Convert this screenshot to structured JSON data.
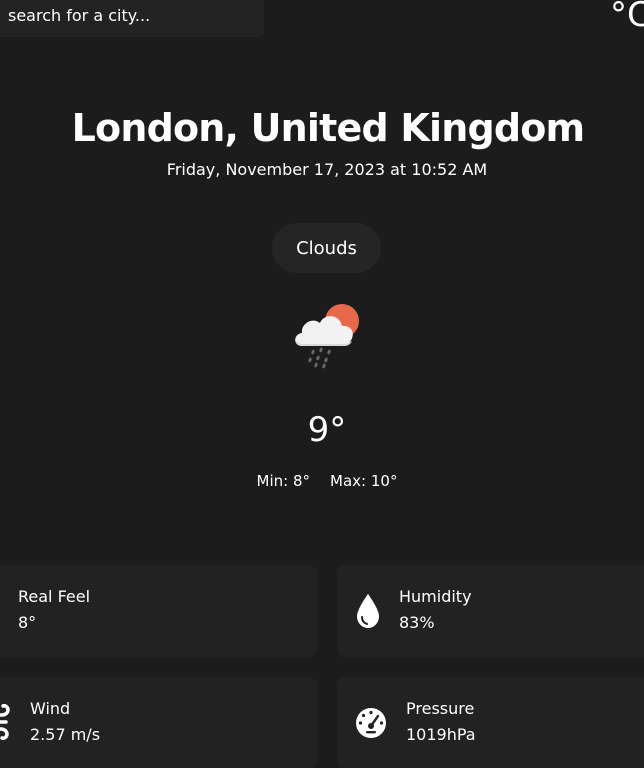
{
  "search": {
    "placeholder": "search for a city..."
  },
  "unit_toggle": {
    "label": "°C"
  },
  "location": {
    "title": "London, United Kingdom",
    "datetime": "Friday, November 17, 2023 at 10:52 AM"
  },
  "current": {
    "condition": "Clouds",
    "condition_icon": "cloud-rain-sun-icon",
    "temperature": "9°",
    "min_label": "Min: 8°",
    "max_label": "Max: 10°"
  },
  "details": [
    {
      "label": "Real Feel",
      "value": "8°",
      "icon": "thermometer-icon"
    },
    {
      "label": "Humidity",
      "value": "83%",
      "icon": "droplet-icon"
    },
    {
      "label": "Wind",
      "value": "2.57 m/s",
      "icon": "wind-icon"
    },
    {
      "label": "Pressure",
      "value": "1019hPa",
      "icon": "gauge-icon"
    }
  ],
  "colors": {
    "background": "#1c1c1c",
    "card": "#222222",
    "sun": "#e8694a",
    "text": "#ffffff"
  }
}
